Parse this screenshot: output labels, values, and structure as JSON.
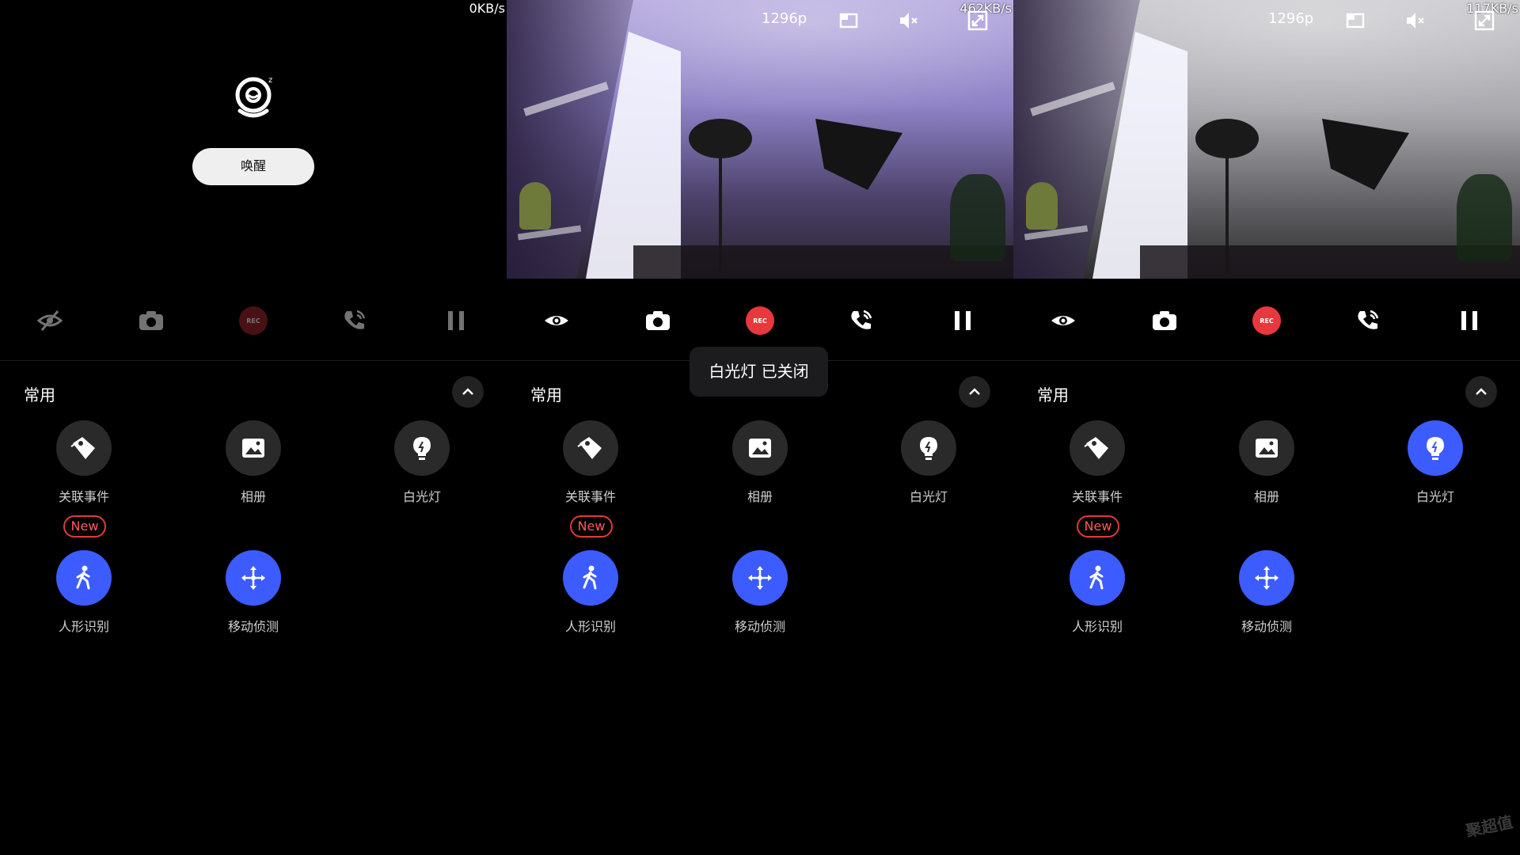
{
  "panels": [
    {
      "speed": "0KB/s",
      "wake_label": "唤醒",
      "section_title": "常用",
      "features": {
        "related_events": "关联事件",
        "album": "相册",
        "white_light": "白光灯",
        "new_badge": "New",
        "human_detection": "人形识别",
        "motion_detection": "移动侦测"
      },
      "rec_label": "REC"
    },
    {
      "speed": "462KB/s",
      "resolution": "1296p",
      "section_title": "常用",
      "features": {
        "related_events": "关联事件",
        "album": "相册",
        "white_light": "白光灯",
        "new_badge": "New",
        "human_detection": "人形识别",
        "motion_detection": "移动侦测"
      },
      "rec_label": "REC"
    },
    {
      "speed": "117KB/s",
      "resolution": "1296p",
      "section_title": "常用",
      "features": {
        "related_events": "关联事件",
        "album": "相册",
        "white_light": "白光灯",
        "new_badge": "New",
        "human_detection": "人形识别",
        "motion_detection": "移动侦测"
      },
      "rec_label": "REC"
    }
  ],
  "toast": "白光灯 已关闭",
  "watermark": "聚超值",
  "colors": {
    "accent_blue": "#3d5cff",
    "rec_red": "#e8383d",
    "new_red": "#e03a3a",
    "background": "#000000"
  },
  "icons": [
    "privacy-off-icon",
    "eye-icon",
    "camera-icon",
    "rec-icon",
    "phone-call-icon",
    "pause-icon",
    "resolution-icon",
    "mute-icon",
    "fullscreen-icon",
    "tag-icon",
    "image-icon",
    "bulb-icon",
    "person-walk-icon",
    "move-arrows-icon",
    "chevron-up-icon",
    "sleep-camera-icon"
  ]
}
